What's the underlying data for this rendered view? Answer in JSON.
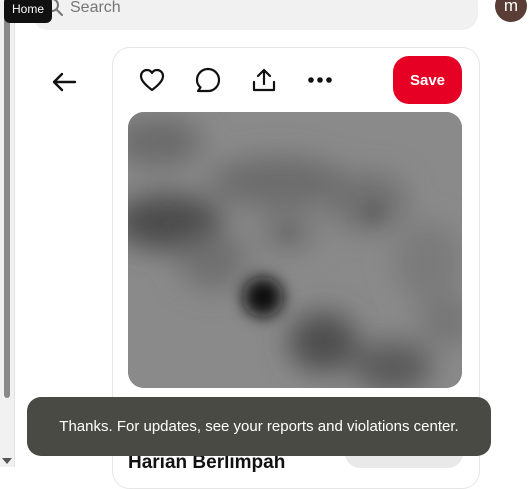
{
  "header": {
    "search_placeholder": "Search",
    "tooltip": "Home",
    "avatar_letter": "m"
  },
  "pin": {
    "save_label": "Save",
    "title": "Harian Berlimpah"
  },
  "toast": {
    "message": "Thanks. For updates, see your reports and violations center."
  },
  "colors": {
    "save_button": "#e60023",
    "toast_bg": "#4a4a45",
    "avatar_bg": "#5a3e36"
  },
  "icons": [
    "search-icon",
    "back-arrow-icon",
    "heart-icon",
    "comment-icon",
    "share-icon",
    "more-icon"
  ]
}
